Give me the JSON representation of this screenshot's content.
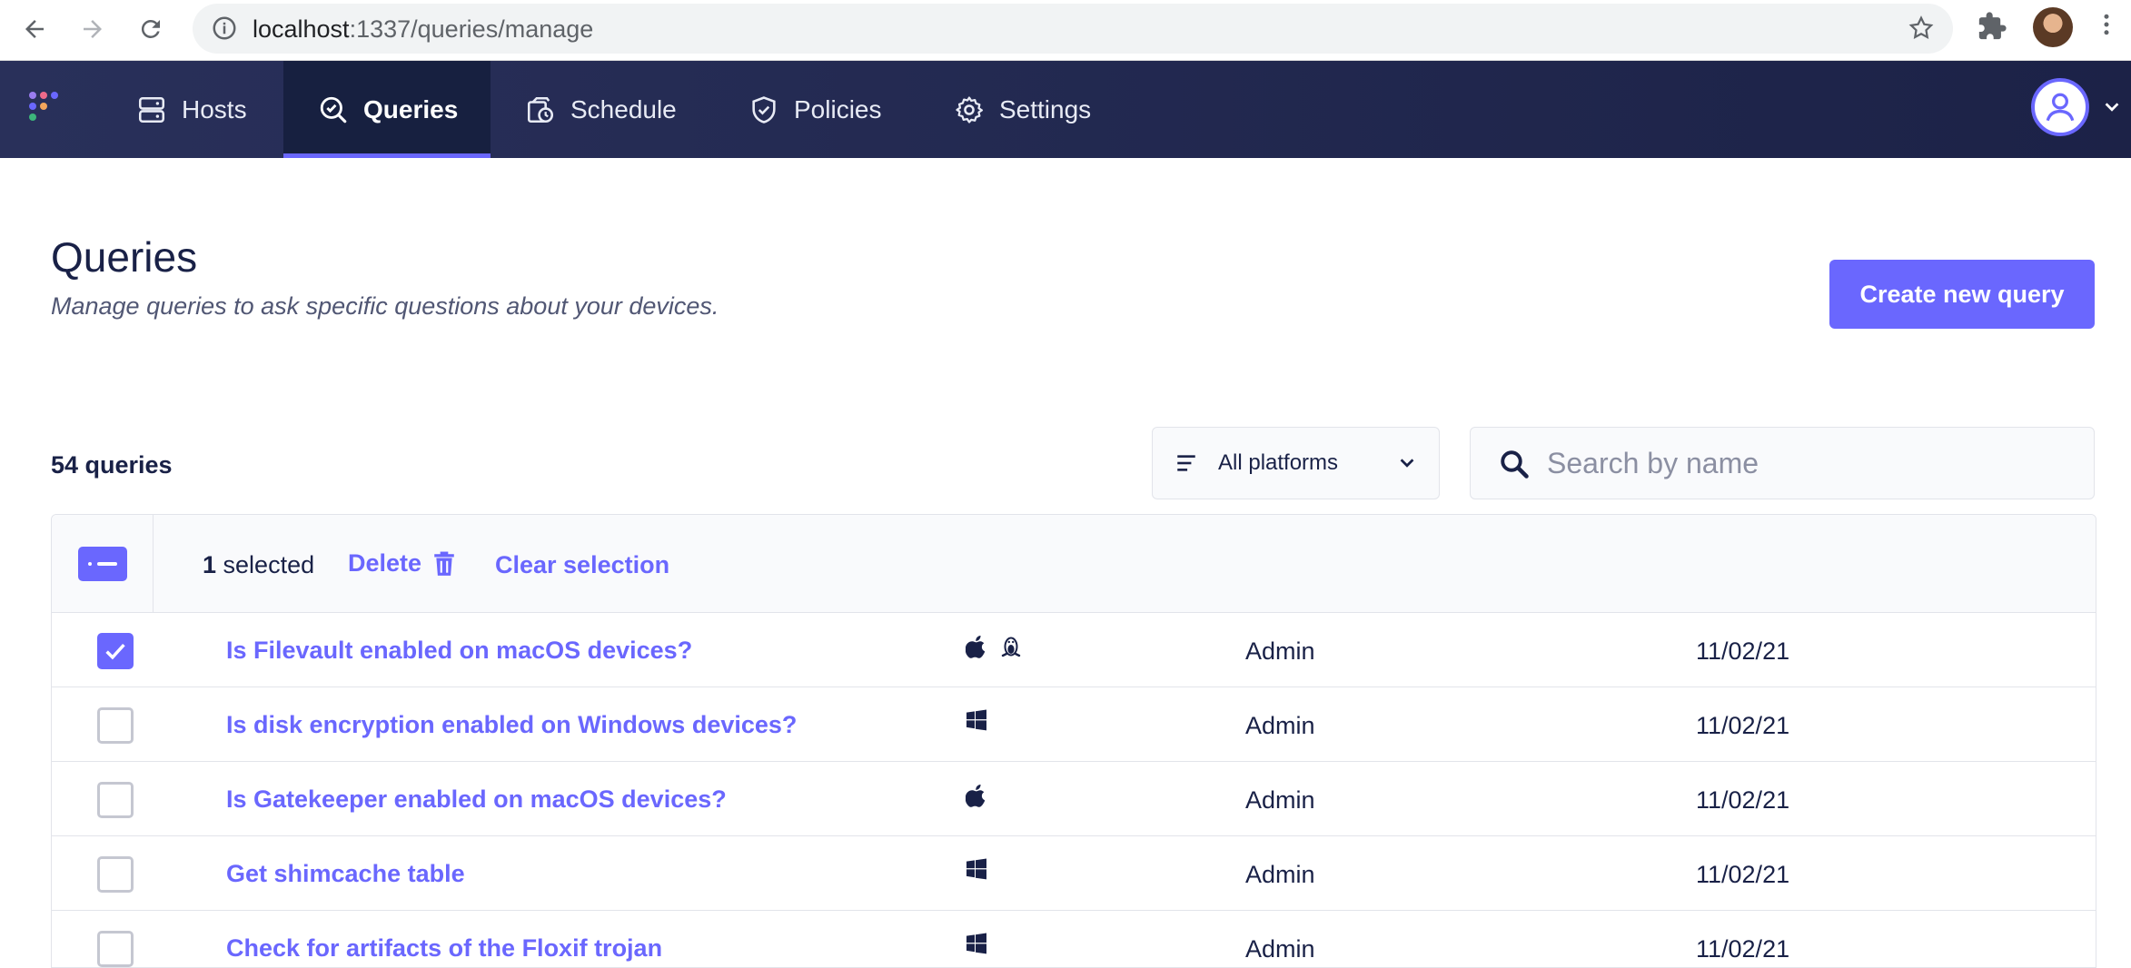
{
  "browser": {
    "url_host": "localhost",
    "url_path": ":1337/queries/manage"
  },
  "nav": {
    "items": [
      {
        "label": "Hosts",
        "icon": "hosts-icon"
      },
      {
        "label": "Queries",
        "icon": "queries-icon",
        "active": true
      },
      {
        "label": "Schedule",
        "icon": "schedule-icon"
      },
      {
        "label": "Policies",
        "icon": "policies-icon"
      },
      {
        "label": "Settings",
        "icon": "gear-icon"
      }
    ]
  },
  "page": {
    "title": "Queries",
    "subtitle": "Manage queries to ask specific questions about your devices.",
    "create_button": "Create new query"
  },
  "toolbar": {
    "count_label": "54 queries",
    "platform_filter": "All platforms",
    "search_placeholder": "Search by name"
  },
  "selection": {
    "count": "1",
    "selected_label": " selected",
    "delete_label": "Delete",
    "clear_label": "Clear selection"
  },
  "rows": [
    {
      "name": "Is Filevault enabled on macOS devices?",
      "platforms": [
        "apple",
        "linux"
      ],
      "author": "Admin",
      "date": "11/02/21",
      "checked": true
    },
    {
      "name": "Is disk encryption enabled on Windows devices?",
      "platforms": [
        "windows"
      ],
      "author": "Admin",
      "date": "11/02/21",
      "checked": false
    },
    {
      "name": "Is Gatekeeper enabled on macOS devices?",
      "platforms": [
        "apple"
      ],
      "author": "Admin",
      "date": "11/02/21",
      "checked": false
    },
    {
      "name": "Get shimcache table",
      "platforms": [
        "windows"
      ],
      "author": "Admin",
      "date": "11/02/21",
      "checked": false
    },
    {
      "name": "Check for artifacts of the Floxif trojan",
      "platforms": [
        "windows"
      ],
      "author": "Admin",
      "date": "11/02/21",
      "checked": false
    }
  ],
  "colors": {
    "accent": "#6a67fe",
    "nav_bg": "#1c2247",
    "text": "#192147"
  }
}
